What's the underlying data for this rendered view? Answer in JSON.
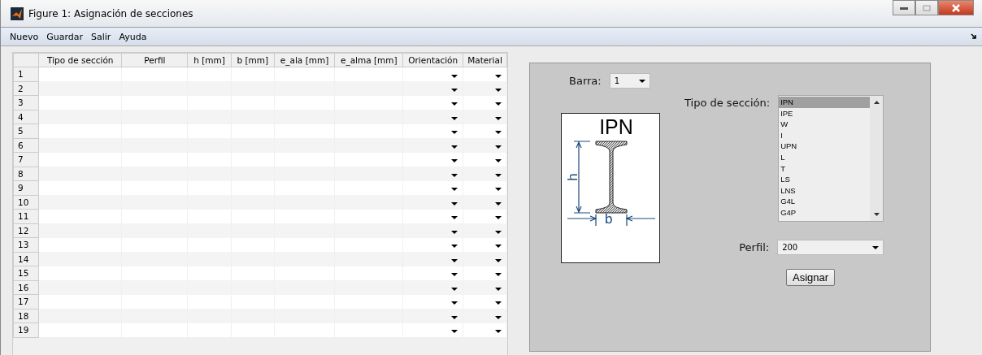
{
  "window": {
    "title": "Figure 1: Asignación de secciones"
  },
  "menu": [
    "Nuevo",
    "Guardar",
    "Salir",
    "Ayuda"
  ],
  "table": {
    "columns": [
      "Tipo de sección",
      "Perfil",
      "h [mm]",
      "b [mm]",
      "e_ala [mm]",
      "e_alma [mm]",
      "Orientación",
      "Material"
    ],
    "rows": [
      {
        "number": "1"
      },
      {
        "number": "2"
      },
      {
        "number": "3"
      },
      {
        "number": "4"
      },
      {
        "number": "5"
      },
      {
        "number": "6"
      },
      {
        "number": "7"
      },
      {
        "number": "8"
      },
      {
        "number": "9"
      },
      {
        "number": "10"
      },
      {
        "number": "11"
      },
      {
        "number": "12"
      },
      {
        "number": "13"
      },
      {
        "number": "14"
      },
      {
        "number": "15"
      },
      {
        "number": "16"
      },
      {
        "number": "17"
      },
      {
        "number": "18"
      },
      {
        "number": "19"
      }
    ]
  },
  "panel": {
    "barra": {
      "label": "Barra:",
      "value": "1"
    },
    "preview": {
      "title": "IPN",
      "h_label": "h",
      "b_label": "b"
    },
    "section_type": {
      "label": "Tipo de sección:",
      "options": [
        {
          "label": "IPN",
          "selected": true
        },
        {
          "label": "IPE",
          "selected": false
        },
        {
          "label": "W",
          "selected": false
        },
        {
          "label": "I",
          "selected": false
        },
        {
          "label": "UPN",
          "selected": false
        },
        {
          "label": "L",
          "selected": false
        },
        {
          "label": "T",
          "selected": false
        },
        {
          "label": "LS",
          "selected": false
        },
        {
          "label": "LNS",
          "selected": false
        },
        {
          "label": "G4L",
          "selected": false
        },
        {
          "label": "G4P",
          "selected": false
        }
      ]
    },
    "perfil": {
      "label": "Perfil:",
      "value": "200"
    },
    "button": "Asignar"
  }
}
